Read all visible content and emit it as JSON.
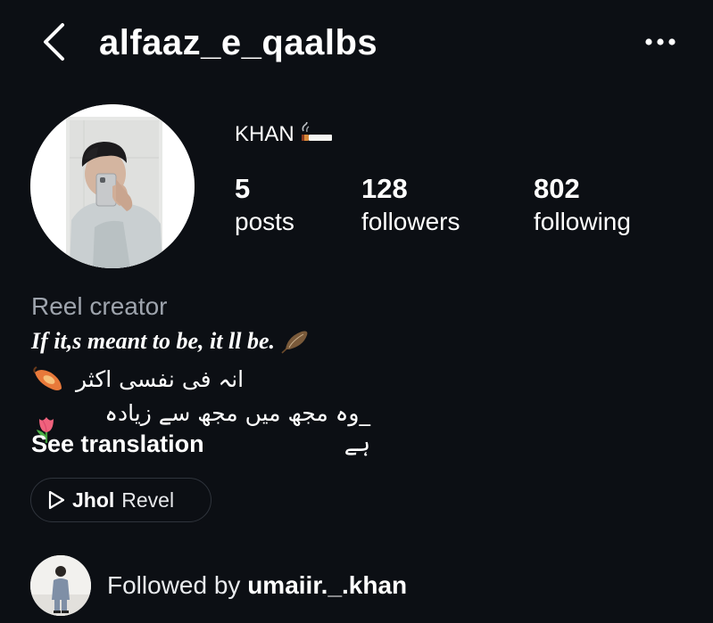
{
  "header": {
    "back_icon": "chevron-left-icon",
    "username": "alfaaz_e_qaalbs",
    "more_icon": "more-horizontal-icon"
  },
  "profile": {
    "display_name": "KHAN",
    "display_name_emoji": "cigarette-emoji",
    "stats": {
      "posts": {
        "count": "5",
        "label": "posts"
      },
      "followers": {
        "count": "128",
        "label": "followers"
      },
      "following": {
        "count": "802",
        "label": "following"
      }
    }
  },
  "bio": {
    "category": "Reel creator",
    "line1": "If it,s meant to be, it ll be.",
    "line1_emoji": "feather-emoji",
    "line2": "انہ فی نفسی اکثر",
    "line2_emoji": "sweet-potato-emoji",
    "line3": "_وہ مجھ میں مجھ سے زیادہ ہے",
    "line3_emoji": "tulip-emoji",
    "see_translation": "See translation"
  },
  "audio": {
    "icon": "play-icon",
    "song": "Jhol",
    "artist": "Revel"
  },
  "followed_by": {
    "prefix": "Followed by",
    "username": "umaiir._.khan"
  },
  "colors": {
    "background": "#0c0f14",
    "text": "#ffffff",
    "muted": "#9ea4ad",
    "chip_border": "#2f343c"
  }
}
